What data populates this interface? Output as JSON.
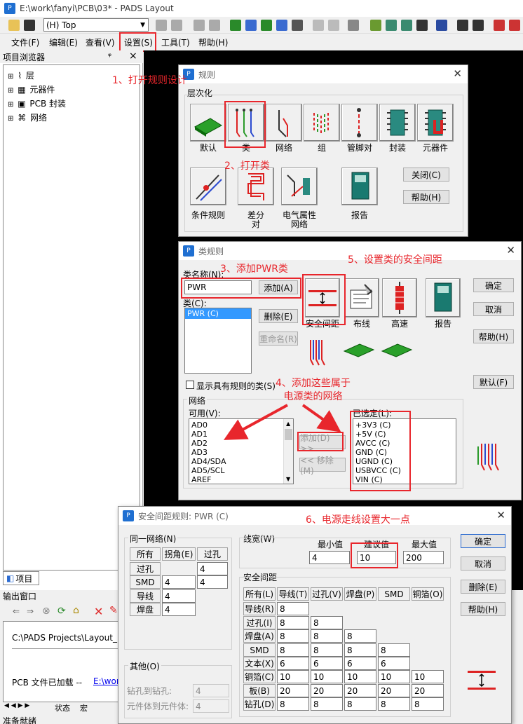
{
  "app": {
    "title": "E:\\work\\fanyi\\PCB\\03* - PADS Layout",
    "layer_select": "(H) Top",
    "menus": [
      "文件(F)",
      "编辑(E)",
      "查看(V)",
      "设置(S)",
      "工具(T)",
      "帮助(H)"
    ],
    "colors": {
      "accent": "#e8262c",
      "selection": "#3399ff",
      "workspace": "#000000"
    }
  },
  "project_browser": {
    "title": "项目浏览器",
    "pin_icon": "ᵠ",
    "close_icon": "×",
    "items": [
      "层",
      "元器件",
      "PCB 封装",
      "网络"
    ],
    "tab": "项目"
  },
  "output": {
    "title": "输出窗口",
    "path": "C:\\PADS Projects\\Layout_",
    "loaded": "PCB 文件已加载  -- ",
    "link": "E:\\wor",
    "tabs": [
      "状态",
      "宏"
    ],
    "status": "准备就绪"
  },
  "rules": {
    "title": "规则",
    "section": "层次化",
    "items": [
      "默认",
      "类",
      "网络",
      "组",
      "管脚对",
      "封装",
      "元器件"
    ],
    "items2": [
      "条件规则",
      "差分\n对",
      "电气属性\n网络",
      "报告"
    ],
    "close": "关闭(C)",
    "help": "帮助(H)"
  },
  "class_rules": {
    "title": "类规则",
    "name_label": "类名称(N):",
    "name_value": "PWR",
    "add": "添加(A)",
    "class_label": "类(C):",
    "classes": [
      "PWR  (C)"
    ],
    "delete": "删除(E)",
    "rename": "重命名(R)",
    "icons": [
      "安全间距",
      "布线",
      "高速",
      "报告"
    ],
    "ok": "确定",
    "cancel": "取消",
    "help": "帮助(H)",
    "default": "默认(F)",
    "show_checkbox": "显示具有规则的类(S)",
    "nets_group": "网络",
    "available_label": "可用(V):",
    "available": [
      "AD0",
      "AD1",
      "AD2",
      "AD3",
      "AD4/SDA",
      "AD5/SCL",
      "AREF"
    ],
    "selected_label": "已选定(L):",
    "selected": [
      "+3V3  (C)",
      "+5V  (C)",
      "AVCC  (C)",
      "GND  (C)",
      "UGND  (C)",
      "USBVCC  (C)",
      "VIN  (C)"
    ],
    "add_nets": "添加(D) >>",
    "remove_nets": "<< 移除(M)"
  },
  "clearance": {
    "title": "安全间距规则:  PWR  (C)",
    "same_net": "同一网络(N)",
    "same_cols": [
      "所有",
      "拐角(E)",
      "过孔"
    ],
    "same_rows": [
      {
        "label": "过孔",
        "v1": "",
        "v2": "4"
      },
      {
        "label": "SMD",
        "v1": "4",
        "v2": "4"
      },
      {
        "label": "导线",
        "v1": "4",
        "v2": ""
      },
      {
        "label": "焊盘",
        "v1": "4",
        "v2": ""
      }
    ],
    "trace_width": "线宽(W)",
    "min_label": "最小值",
    "rec_label": "建议值",
    "max_label": "最大值",
    "min_value": "4",
    "rec_value": "10",
    "max_value": "200",
    "clearance_section": "安全间距",
    "cols": [
      "所有(L)",
      "导线(T)",
      "过孔(V)",
      "焊盘(P)",
      "SMD",
      "铜箔(O)"
    ],
    "rows": [
      {
        "label": "导线(R)",
        "values": [
          "8"
        ]
      },
      {
        "label": "过孔(I)",
        "values": [
          "8",
          "8"
        ]
      },
      {
        "label": "焊盘(A)",
        "values": [
          "8",
          "8",
          "8"
        ]
      },
      {
        "label": "SMD",
        "values": [
          "8",
          "8",
          "8",
          "8"
        ]
      },
      {
        "label": "文本(X)",
        "values": [
          "6",
          "6",
          "6",
          "6"
        ]
      },
      {
        "label": "铜箔(C)",
        "values": [
          "10",
          "10",
          "10",
          "10",
          "10"
        ]
      },
      {
        "label": "板(B)",
        "values": [
          "20",
          "20",
          "20",
          "20",
          "20"
        ]
      },
      {
        "label": "钻孔(D)",
        "values": [
          "8",
          "8",
          "8",
          "8",
          "8"
        ]
      }
    ],
    "other": "其他(O)",
    "drill_label": "钻孔到钻孔:",
    "drill_value": "4",
    "comp_label": "元件体到元件体:",
    "comp_value": "4",
    "ok": "确定",
    "cancel": "取消",
    "delete": "删除(E)",
    "help": "帮助(H)"
  },
  "annotations": {
    "a1": "1、打开规则设计",
    "a2": "2、打开类",
    "a3": "3、添加PWR类",
    "a4": "4、添加这些属于\n电源类的网络",
    "a5": "5、设置类的安全间距",
    "a6": "6、电源走线设置大一点"
  }
}
